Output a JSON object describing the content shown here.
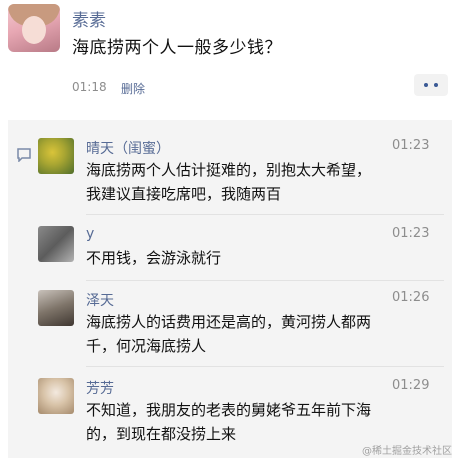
{
  "post": {
    "author": "素素",
    "text": "海底捞两个人一般多少钱？",
    "time": "01:18",
    "delete_label": "删除"
  },
  "comments": [
    {
      "name": "晴天（闺蜜）",
      "time": "01:23",
      "lines": [
        "海底捞两个人估计挺难的，别抱太大希望，",
        "我建议直接吃席吧，我随两百"
      ]
    },
    {
      "name": "y",
      "time": "01:23",
      "lines": [
        "不用钱，会游泳就行"
      ]
    },
    {
      "name": "泽天",
      "time": "01:26",
      "lines": [
        "海底捞人的话费用还是高的，黄河捞人都两",
        "千，何况海底捞人"
      ]
    },
    {
      "name": "芳芳",
      "time": "01:29",
      "lines": [
        "不知道，我朋友的老表的舅姥爷五年前下海",
        "的，到现在都没捞上来"
      ]
    }
  ],
  "watermark": "@稀土掘金技术社区",
  "icons": {
    "comment": "comment-bubble-icon",
    "more": "more-dots-icon"
  },
  "colors": {
    "link": "#576b95",
    "comment_bg": "#f4f4f4"
  }
}
